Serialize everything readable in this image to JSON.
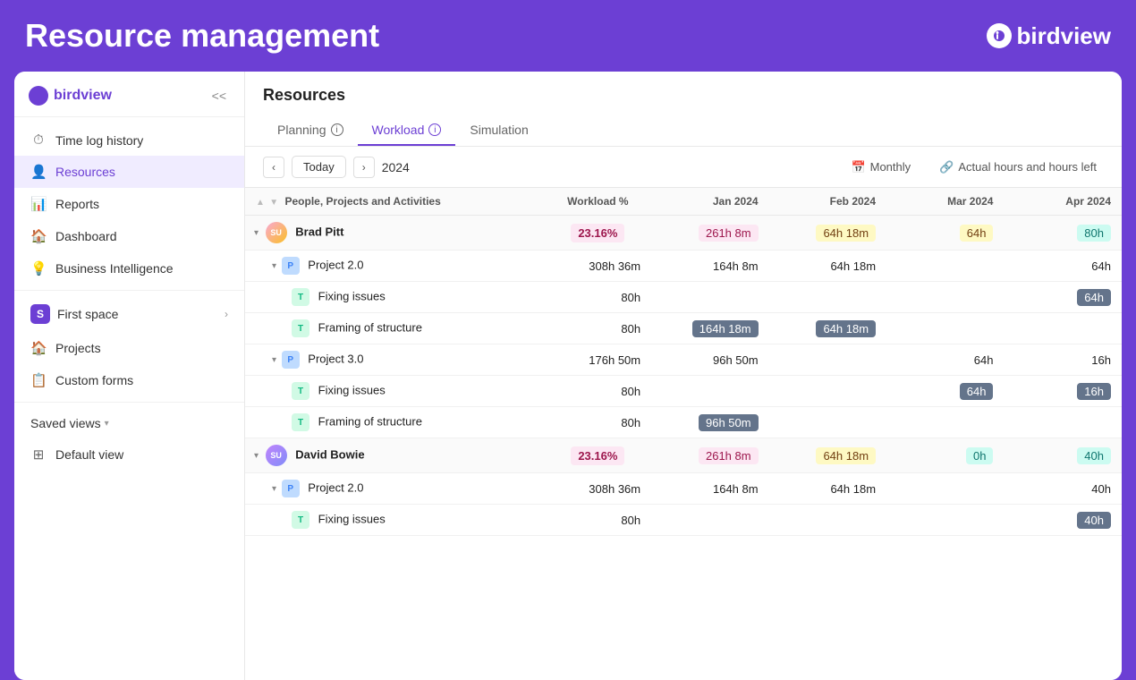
{
  "app": {
    "title": "Resource management",
    "logo": "birdview"
  },
  "sidebar": {
    "logo": "birdview",
    "collapse_label": "<<",
    "nav_items": [
      {
        "id": "time-log-history",
        "label": "Time log history",
        "icon": "⏱"
      },
      {
        "id": "resources",
        "label": "Resources",
        "icon": "👤",
        "active": true
      },
      {
        "id": "reports",
        "label": "Reports",
        "icon": "📊"
      },
      {
        "id": "dashboard",
        "label": "Dashboard",
        "icon": "🏠"
      },
      {
        "id": "business-intelligence",
        "label": "Business Intelligence",
        "icon": "💡"
      }
    ],
    "space": {
      "badge": "S",
      "label": "First space"
    },
    "space_sub_items": [
      {
        "id": "projects",
        "label": "Projects",
        "icon": "🏠"
      },
      {
        "id": "custom-forms",
        "label": "Custom forms",
        "icon": "📋"
      }
    ],
    "saved_views": "Saved views",
    "default_view": "Default view"
  },
  "content": {
    "title": "Resources",
    "tabs": [
      {
        "id": "planning",
        "label": "Planning",
        "info": true,
        "active": false
      },
      {
        "id": "workload",
        "label": "Workload",
        "info": true,
        "active": true
      },
      {
        "id": "simulation",
        "label": "Simulation",
        "info": false,
        "active": false
      }
    ],
    "toolbar": {
      "today": "Today",
      "year": "2024",
      "monthly": "Monthly",
      "actual_hours": "Actual hours and hours left"
    },
    "table": {
      "headers": [
        {
          "id": "name",
          "label": "People, Projects and Activities"
        },
        {
          "id": "workload",
          "label": "Workload %"
        },
        {
          "id": "jan",
          "label": "Jan 2024"
        },
        {
          "id": "feb",
          "label": "Feb 2024"
        },
        {
          "id": "mar",
          "label": "Mar 2024"
        },
        {
          "id": "apr",
          "label": "Apr 2024"
        }
      ],
      "rows": [
        {
          "type": "person",
          "indent": 0,
          "avatar": "SU",
          "name": "Brad Pitt",
          "workload": "23.16%",
          "workload_style": "pink",
          "jan": "261h 8m",
          "jan_style": "pink",
          "feb": "64h 18m",
          "feb_style": "yellow",
          "mar": "64h",
          "mar_style": "yellow",
          "apr": "80h",
          "apr_style": "teal"
        },
        {
          "type": "project",
          "indent": 1,
          "badge": "P",
          "name": "Project 2.0",
          "workload": "308h 36m",
          "jan": "164h 8m",
          "feb": "64h 18m",
          "mar": "",
          "apr": "64h"
        },
        {
          "type": "task",
          "indent": 2,
          "badge": "T",
          "name": "Fixing issues",
          "workload": "80h",
          "jan": "",
          "feb": "",
          "mar": "",
          "apr": "64h",
          "apr_style": "gray"
        },
        {
          "type": "task",
          "indent": 2,
          "badge": "T",
          "name": "Framing of structure",
          "workload": "80h",
          "jan": "164h 18m",
          "jan_style": "gray",
          "feb": "64h 18m",
          "feb_style": "gray",
          "mar": "",
          "apr": ""
        },
        {
          "type": "project",
          "indent": 1,
          "badge": "P",
          "name": "Project 3.0",
          "workload": "176h 50m",
          "jan": "96h 50m",
          "feb": "",
          "mar": "64h",
          "apr": "16h"
        },
        {
          "type": "task",
          "indent": 2,
          "badge": "T",
          "name": "Fixing issues",
          "workload": "80h",
          "jan": "",
          "feb": "",
          "mar": "64h",
          "mar_style": "gray",
          "apr": "16h",
          "apr_style": "gray"
        },
        {
          "type": "task",
          "indent": 2,
          "badge": "T",
          "name": "Framing of structure",
          "workload": "80h",
          "jan": "96h 50m",
          "jan_style": "gray",
          "feb": "",
          "mar": "",
          "apr": ""
        },
        {
          "type": "person",
          "indent": 0,
          "avatar": "SU2",
          "name": "David Bowie",
          "workload": "23.16%",
          "workload_style": "pink",
          "jan": "261h 8m",
          "jan_style": "pink",
          "feb": "64h 18m",
          "feb_style": "yellow",
          "mar": "0h",
          "mar_style": "teal",
          "apr": "40h",
          "apr_style": "teal"
        },
        {
          "type": "project",
          "indent": 1,
          "badge": "P",
          "name": "Project 2.0",
          "workload": "308h 36m",
          "jan": "164h 8m",
          "feb": "64h 18m",
          "mar": "",
          "apr": "40h"
        },
        {
          "type": "task",
          "indent": 2,
          "badge": "T",
          "name": "Fixing issues",
          "workload": "80h",
          "jan": "",
          "feb": "",
          "mar": "",
          "apr": "40h",
          "apr_style": "gray"
        }
      ]
    }
  }
}
